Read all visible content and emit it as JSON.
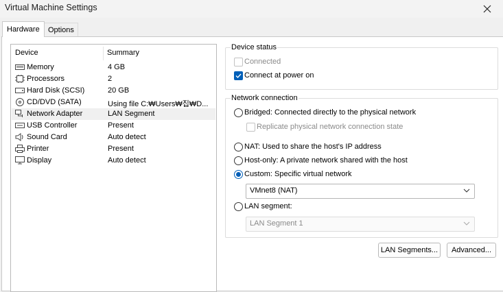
{
  "window": {
    "title": "Virtual Machine Settings"
  },
  "tabs": [
    {
      "label": "Hardware",
      "active": true
    },
    {
      "label": "Options",
      "active": false
    }
  ],
  "device_table": {
    "columns": [
      "Device",
      "Summary"
    ],
    "rows": [
      {
        "icon": "memory-icon",
        "device": "Memory",
        "summary": "4 GB"
      },
      {
        "icon": "processor-icon",
        "device": "Processors",
        "summary": "2"
      },
      {
        "icon": "hard-disk-icon",
        "device": "Hard Disk (SCSI)",
        "summary": "20 GB"
      },
      {
        "icon": "cd-dvd-icon",
        "device": "CD/DVD (SATA)",
        "summary": "Using file C:₩Users₩집₩D..."
      },
      {
        "icon": "network-adapter-icon",
        "device": "Network Adapter",
        "summary": "LAN Segment",
        "selected": true
      },
      {
        "icon": "usb-icon",
        "device": "USB Controller",
        "summary": "Present"
      },
      {
        "icon": "sound-card-icon",
        "device": "Sound Card",
        "summary": "Auto detect"
      },
      {
        "icon": "printer-icon",
        "device": "Printer",
        "summary": "Present"
      },
      {
        "icon": "display-icon",
        "device": "Display",
        "summary": "Auto detect"
      }
    ]
  },
  "device_status": {
    "title": "Device status",
    "connected": {
      "label": "Connected",
      "checked": false,
      "enabled": false
    },
    "connect_at_power_on": {
      "label": "Connect at power on",
      "checked": true
    }
  },
  "network_connection": {
    "title": "Network connection",
    "bridged": {
      "label": "Bridged: Connected directly to the physical network",
      "selected": false
    },
    "replicate": {
      "label": "Replicate physical network connection state",
      "checked": false,
      "enabled": false
    },
    "nat": {
      "label": "NAT: Used to share the host's IP address",
      "selected": false
    },
    "host_only": {
      "label": "Host-only: A private network shared with the host",
      "selected": false
    },
    "custom": {
      "label": "Custom: Specific virtual network",
      "selected": true
    },
    "custom_network_value": "VMnet8 (NAT)",
    "lan_segment": {
      "label": "LAN segment:",
      "selected": false
    },
    "lan_segment_value": "LAN Segment 1"
  },
  "buttons": {
    "lan_segments": "LAN Segments...",
    "advanced": "Advanced..."
  },
  "colors": {
    "accent": "#005fb8",
    "selected_row": "#f0f0f0"
  },
  "icons": {
    "close": "close-icon",
    "dropdown": "chevron-down-icon"
  }
}
